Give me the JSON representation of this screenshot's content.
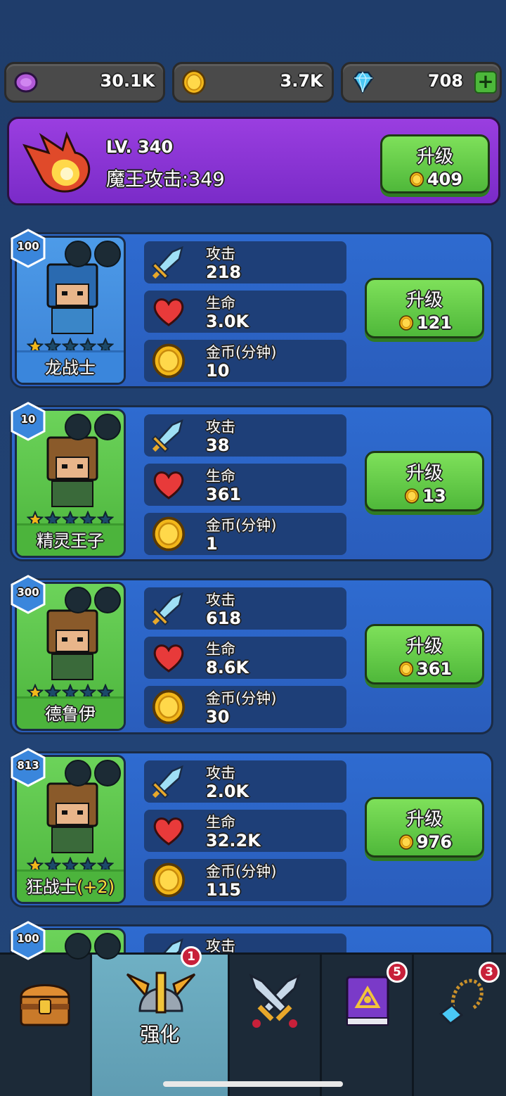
{
  "currencies": [
    {
      "icon": "purple-gem-icon",
      "value": "30.1K"
    },
    {
      "icon": "gold-coin-icon",
      "value": "3.7K"
    },
    {
      "icon": "diamond-icon",
      "value": "708"
    }
  ],
  "boss": {
    "level": "LV. 340",
    "attack": "魔王攻击:349",
    "upgrade_label": "升级",
    "upgrade_cost": "409"
  },
  "hero_labels": {
    "attack": "攻击",
    "health": "生命",
    "gold": "金币(分钟)",
    "upgrade": "升级"
  },
  "heroes": [
    {
      "level": "100",
      "name": "龙战士",
      "name_extra": "",
      "stars": "1/5",
      "attack": "218",
      "health": "3.0K",
      "gold": "10",
      "upgrade_cost": "121",
      "theme": "blue"
    },
    {
      "level": "10",
      "name": "精灵王子",
      "name_extra": "",
      "stars": "1/5",
      "attack": "38",
      "health": "361",
      "gold": "1",
      "upgrade_cost": "13",
      "theme": "green"
    },
    {
      "level": "300",
      "name": "德鲁伊",
      "name_extra": "",
      "stars": "1/5",
      "attack": "618",
      "health": "8.6K",
      "gold": "30",
      "upgrade_cost": "361",
      "theme": "green"
    },
    {
      "level": "813",
      "name": "狂战士",
      "name_extra": "(+2)",
      "stars": "1/5",
      "attack": "2.0K",
      "health": "32.2K",
      "gold": "115",
      "upgrade_cost": "976",
      "theme": "green"
    },
    {
      "level": "100",
      "name": "",
      "name_extra": "",
      "stars": "",
      "attack": "",
      "health": "",
      "gold": "",
      "upgrade_cost": "",
      "theme": "green"
    }
  ],
  "nav": {
    "items": [
      {
        "icon": "treasure-chest-icon",
        "label": "",
        "badge": ""
      },
      {
        "icon": "winged-helmet-icon",
        "label": "强化",
        "badge": "1"
      },
      {
        "icon": "crossed-swords-icon",
        "label": "",
        "badge": ""
      },
      {
        "icon": "spell-book-icon",
        "label": "",
        "badge": "5"
      },
      {
        "icon": "amulet-icon",
        "label": "",
        "badge": "3"
      }
    ]
  },
  "colors": {
    "accent_green": "#4fb83a",
    "boss_purple": "#8a35d8",
    "card_blue": "#2e6bd0"
  }
}
